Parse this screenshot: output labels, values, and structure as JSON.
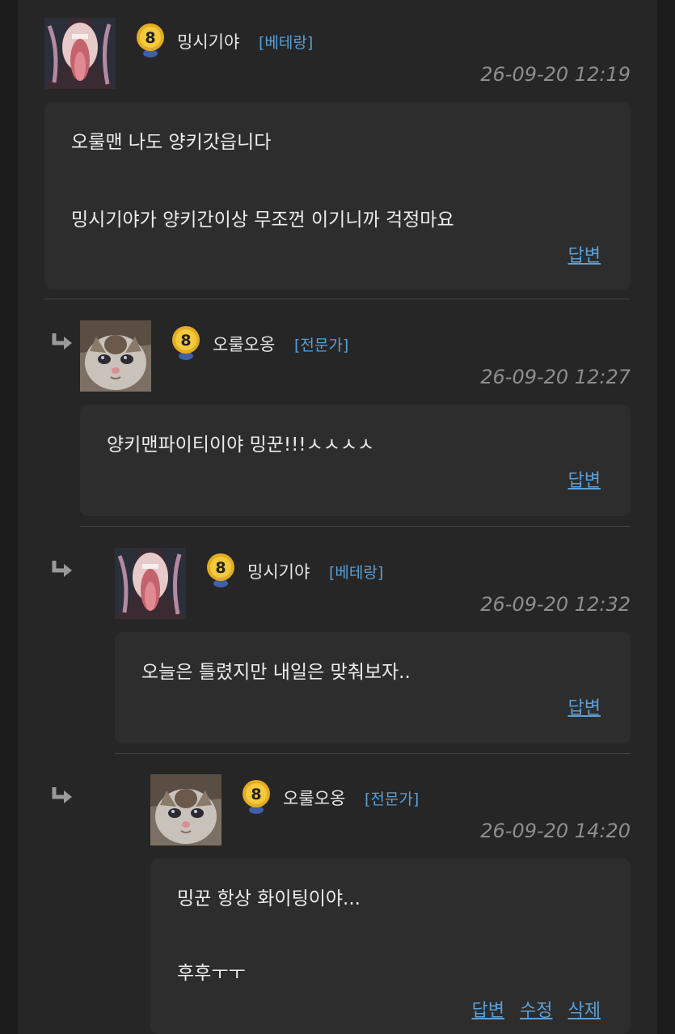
{
  "comments": [
    {
      "nick": "밍시기야",
      "rank": "[베테랑]",
      "level": "8",
      "date": "26-09-20 12:19",
      "lines": [
        "오룰맨 나도 양키갓읍니다",
        "",
        "밍시기야가 양키간이상 무조껀 이기니까 걱정마요"
      ],
      "actions": [
        "답변"
      ]
    },
    {
      "nick": "오룰오옹",
      "rank": "[전문가]",
      "level": "8",
      "date": "26-09-20 12:27",
      "lines": [
        "양키맨파이티이야 밍꾼!!!ㅅㅅㅅㅅ"
      ],
      "actions": [
        "답변"
      ]
    },
    {
      "nick": "밍시기야",
      "rank": "[베테랑]",
      "level": "8",
      "date": "26-09-20 12:32",
      "lines": [
        "오늘은 틀렸지만 내일은 맞춰보자.."
      ],
      "actions": [
        "답변"
      ]
    },
    {
      "nick": "오룰오옹",
      "rank": "[전문가]",
      "level": "8",
      "date": "26-09-20 14:20",
      "lines": [
        "밍꾼 항상 화이팅이야...",
        "",
        "후후ㅜㅜ"
      ],
      "actions": [
        "답변",
        "수정",
        "삭제"
      ]
    }
  ]
}
